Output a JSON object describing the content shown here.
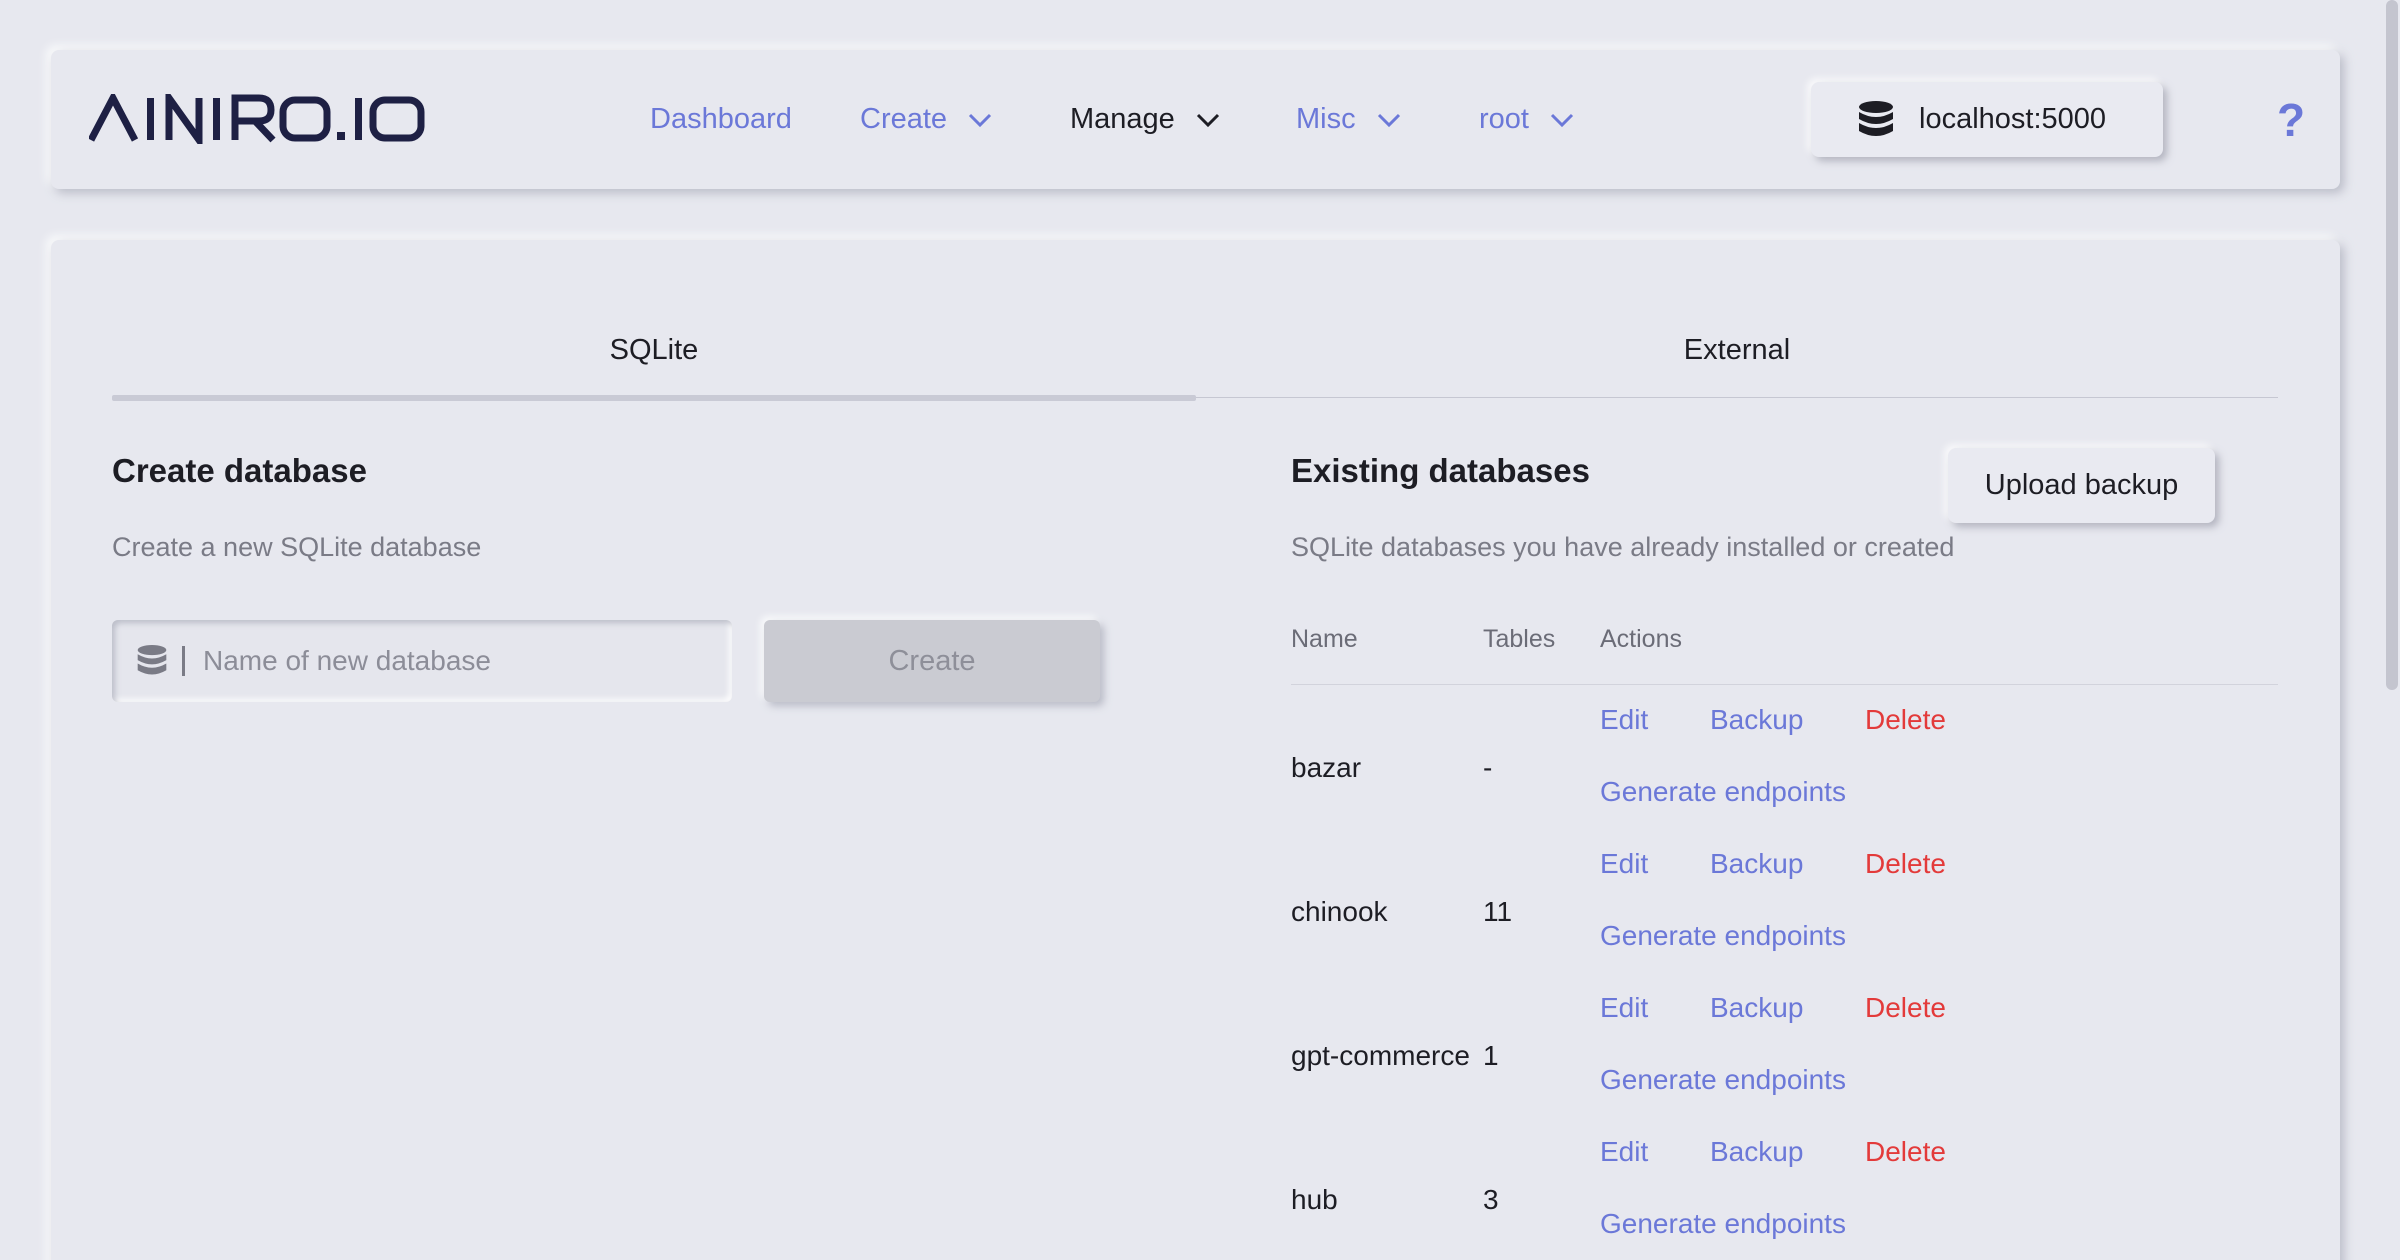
{
  "brand": {
    "logo_text": "AINIRO.IO"
  },
  "nav": {
    "dashboard": "Dashboard",
    "create": "Create",
    "manage": "Manage",
    "misc": "Misc",
    "root": "root"
  },
  "server": {
    "label": "localhost:5000"
  },
  "help": {
    "label": "?"
  },
  "tabs": {
    "sqlite": "SQLite",
    "external": "External"
  },
  "create_section": {
    "title": "Create database",
    "subtitle": "Create a new SQLite database",
    "input_placeholder": "Name of new database",
    "input_value": "",
    "create_button": "Create"
  },
  "existing_section": {
    "title": "Existing databases",
    "subtitle": "SQLite databases you have already installed or created",
    "upload_button": "Upload backup",
    "columns": {
      "name": "Name",
      "tables": "Tables",
      "actions": "Actions"
    },
    "rows": [
      {
        "name": "bazar",
        "tables": "-",
        "edit": "Edit",
        "backup": "Backup",
        "delete": "Delete",
        "generate": "Generate endpoints"
      },
      {
        "name": "chinook",
        "tables": "11",
        "edit": "Edit",
        "backup": "Backup",
        "delete": "Delete",
        "generate": "Generate endpoints"
      },
      {
        "name": "gpt-commerce",
        "tables": "1",
        "edit": "Edit",
        "backup": "Backup",
        "delete": "Delete",
        "generate": "Generate endpoints"
      },
      {
        "name": "hub",
        "tables": "3",
        "edit": "Edit",
        "backup": "Backup",
        "delete": "Delete",
        "generate": "Generate endpoints"
      }
    ]
  },
  "colors": {
    "accent": "#6b78d8",
    "danger": "#e33a3a",
    "background": "#e7e8ef",
    "text": "#1d1d24"
  },
  "icons": {
    "database": "database-icon",
    "chevron": "chevron-down-icon",
    "help": "question-icon"
  }
}
